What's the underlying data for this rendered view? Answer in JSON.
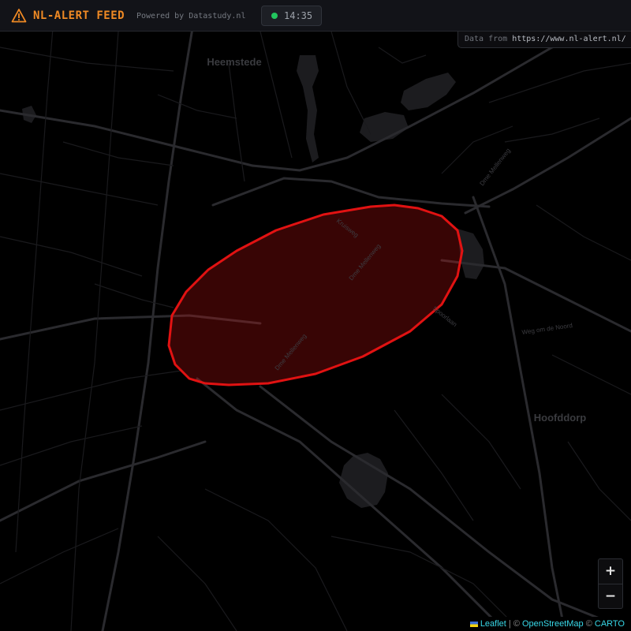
{
  "header": {
    "title": "NL-ALERT FEED",
    "powered_by": "Powered by Datastudy.nl",
    "time": "14:35",
    "icon": "warning-triangle-icon",
    "accent_color": "#f08a24",
    "status_color": "#22c55e"
  },
  "source": {
    "label": "Data from",
    "url": "https://www.nl-alert.nl/"
  },
  "map": {
    "places": {
      "heemstede": "Heemstede",
      "hoofddorp": "Hoofddorp"
    },
    "streets": {
      "kruisweg": "Kruisweg",
      "dme_1": "Dme Mellenweg",
      "dme_2": "Dme Mellenweg",
      "dme_3": "Dme Mellenweg",
      "spoorlaan": "Spoorlaan",
      "weg_om_de_noord": "Weg om de Noord"
    },
    "alert_area_color": "#e11212"
  },
  "zoom": {
    "in_label": "+",
    "out_label": "−"
  },
  "attribution": {
    "leaflet": "Leaflet",
    "osm": "OpenStreetMap",
    "carto": "CARTO",
    "separator": "|",
    "copyright": "©"
  }
}
